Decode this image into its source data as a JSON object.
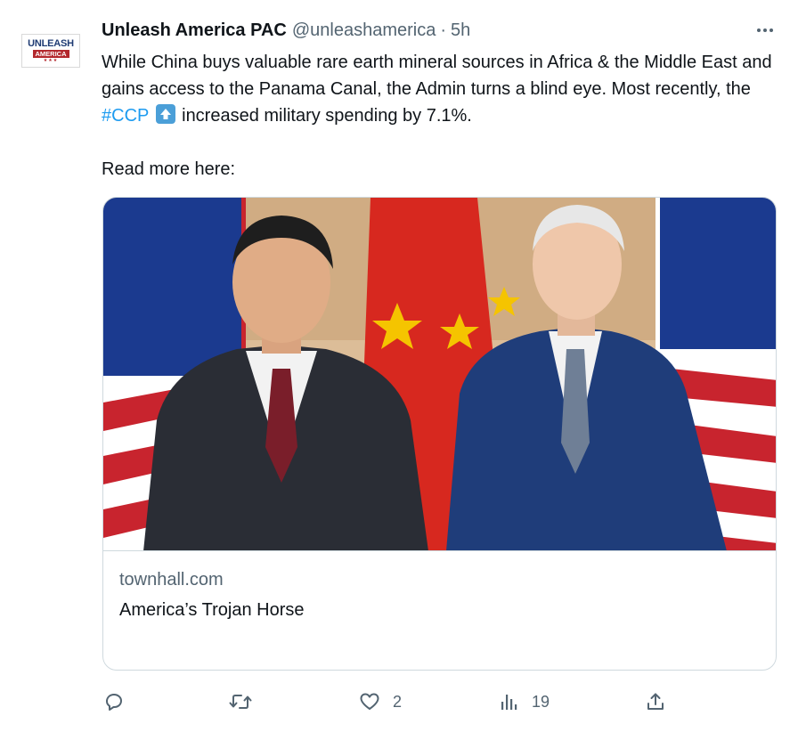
{
  "tweet": {
    "author": {
      "display_name": "Unleash America PAC",
      "handle": "@unleashamerica",
      "avatar_line1": "UNLEASH",
      "avatar_line2": "AMERICA",
      "avatar_stars": "★★★"
    },
    "separator": "·",
    "time": "5h",
    "text": {
      "part1": "While China buys valuable rare earth mineral sources in Africa & the Middle East and gains access to the Panama Canal, the Admin turns a blind eye. Most recently, the ",
      "hashtag": "#CCP",
      "part2": " increased military spending by 7.1%.",
      "read_more": "Read more here:"
    },
    "card": {
      "domain": "townhall.com",
      "title": "America’s Trojan Horse",
      "image_icon": "photo-two-leaders-in-suits-before-flags"
    },
    "actions": {
      "reply_icon": "reply-icon",
      "retweet_icon": "retweet-icon",
      "like_icon": "heart-icon",
      "like_count": "2",
      "views_icon": "views-icon",
      "views_count": "19",
      "share_icon": "share-icon"
    }
  },
  "colors": {
    "text": "#0f1419",
    "muted": "#536471",
    "link": "#1d9bf0",
    "border": "#cfd9de"
  }
}
